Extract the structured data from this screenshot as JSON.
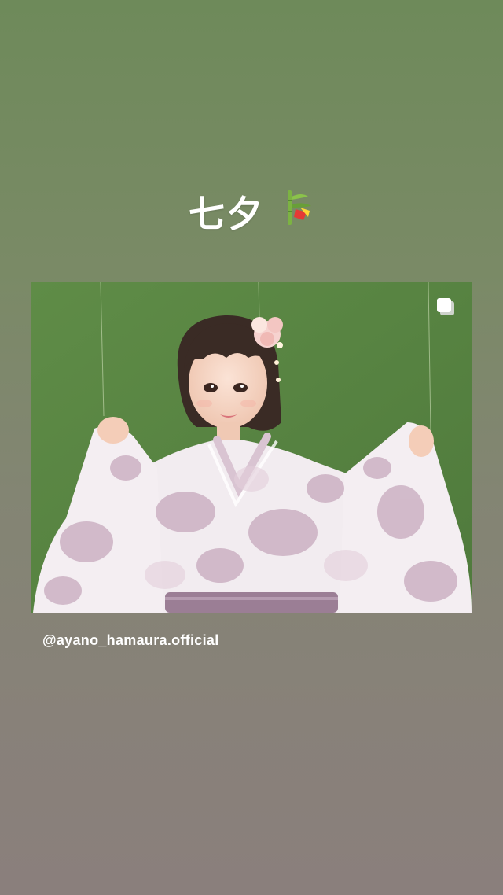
{
  "story": {
    "caption_text": "七夕",
    "caption_emoji": "tanabata-tree-icon"
  },
  "post": {
    "handle": "@ayano_hamaura.official",
    "multi_image_icon": "carousel-icon",
    "photo_description_icon": "portrait-photo"
  },
  "colors": {
    "bg_top": "#6e8a5a",
    "bg_bottom": "#8a7f7c",
    "photo_bg": "#5d8a46",
    "kimono": "#f3eef2",
    "kimono_pattern": "#c7a9bd",
    "obi": "#9b7e95"
  }
}
